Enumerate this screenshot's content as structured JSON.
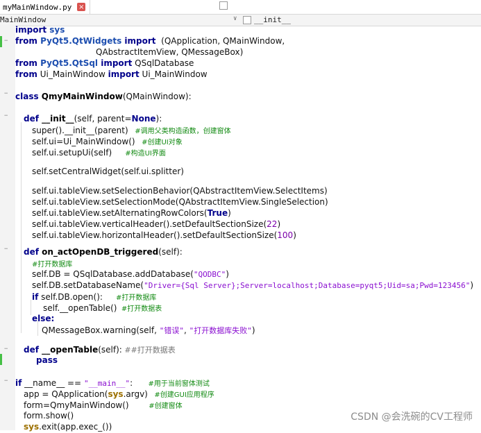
{
  "tab": {
    "filename": "myMainWindow.py",
    "close_glyph": "×"
  },
  "breadcrumb": {
    "class_name": "MainWindow",
    "member": "__init__",
    "arrow": "∨"
  },
  "code": {
    "l1_kw": "import",
    "l1_mod": " sys",
    "l2_kw": "from",
    "l2_mod": " PyQt5.QtWidgets",
    "l2_kw2": " import",
    "l2_rest": "  (QApplication, QMainWindow,",
    "l3_rest": "QAbstractItemView, QMessageBox)",
    "l4_kw": "from",
    "l4_mod": " PyQt5.QtSql",
    "l4_kw2": " import",
    "l4_rest": " QSqlDatabase",
    "l5_kw": "from",
    "l5_rest": " Ui_MainWindow ",
    "l5_kw2": "import",
    "l5_rest2": " Ui_MainWindow",
    "l7_kw": "class",
    "l7_cls": " QmyMainWindow",
    "l7_rest": "(QMainWindow):",
    "l9_kw": "def",
    "l9_cls": " __init__",
    "l9_rest": "(self, parent=",
    "l9_none": "None",
    "l9_end": "):",
    "l10_a": "super().__init__(parent)",
    "l10_cm": "   #调用父类构造函数，创建窗体",
    "l11_a": "self.ui=Ui_MainWindow()",
    "l11_cm": "   #创建UI对象",
    "l12_a": "self.ui.setupUi(self)",
    "l12_cm": "      #构造UI界面",
    "l14_a": "self.setCentralWidget(self.ui.splitter)",
    "l16_a": "self.ui.tableView.setSelectionBehavior(QAbstractItemView.SelectItems)",
    "l17_a": "self.ui.tableView.setSelectionMode(QAbstractItemView.SingleSelection)",
    "l18_a": "self.ui.tableView.setAlternatingRowColors(",
    "l18_b": "True",
    "l18_c": ")",
    "l19_a": "self.ui.tableView.verticalHeader().setDefaultSectionSize(",
    "l19_b": "22",
    "l19_c": ")",
    "l20_a": "self.ui.tableView.horizontalHeader().setDefaultSectionSize(",
    "l20_b": "100",
    "l20_c": ")",
    "l22_kw": "def",
    "l22_cls": " on_actOpenDB_triggered",
    "l22_rest": "(self):",
    "l23_cm": "#打开数据库",
    "l24_a": "self.DB = QSqlDatabase.addDatabase(",
    "l24_s": "\"QODBC\"",
    "l24_c": ")",
    "l25_a": "self.DB.setDatabaseName(",
    "l25_s": "\"Driver={Sql Server};Server=localhost;Database=pyqt5;Uid=sa;Pwd=123456\"",
    "l25_c": ")",
    "l26_kw": "if",
    "l26_a": " self.DB.open():",
    "l26_cm": "      #打开数据库",
    "l27_a": "self.__openTable()",
    "l27_cm": "  #打开数据表",
    "l28_kw": "else:",
    "l29_a": "QMessageBox.warning(self, ",
    "l29_s1": "\"错误\"",
    "l29_b": ", ",
    "l29_s2": "\"打开数据库失败\"",
    "l29_c": ")",
    "l31_kw": "def",
    "l31_cls": " __openTable",
    "l31_rest": "(self):",
    "l31_cm": " ##打开数据表",
    "l32_kw": "pass",
    "l34_kw": "if",
    "l34_a": " __name__ == ",
    "l34_s": "\"__main__\"",
    "l34_b": ":",
    "l34_cm": "       #用于当前窗体测试",
    "l35_a": "app = QApplication(",
    "l35_bi": "sys",
    "l35_b": ".argv)",
    "l35_cm": "   #创建GUI应用程序",
    "l36_a": "form=QmyMainWindow()",
    "l36_cm": "         #创建窗体",
    "l37_a": "form.show()",
    "l38_bi": "sys",
    "l38_a": ".exit(app.exec_())"
  },
  "watermark": "CSDN @会洗碗的CV工程师"
}
